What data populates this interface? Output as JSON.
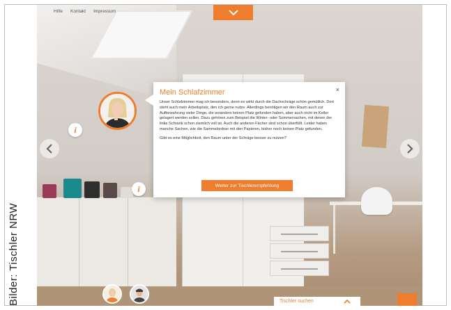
{
  "credit": "Bilder: Tischler NRW",
  "topnav": {
    "help": "Hilfe",
    "contact": "Kontakt",
    "imprint": "Impressum"
  },
  "dialog": {
    "title": "Mein Schlafzimmer",
    "close": "×",
    "paragraph1": "Unser Schlafzimmer mag ich besonders, denn es wirkt durch die Dachschräge schön gemütlich. Dort steht auch mein Arbeitsplatz, den ich gerne nutze. Allerdings benötigen wir den Raum auch zur Aufbewahrung vieler Dinge, die woanders keinen Platz gefunden haben, aber auch nicht im Keller gelagert werden sollen. Dazu gehören zum Beispiel die Winter- oder Sommersachen, mit denen der linke Schrank schon ziemlich voll ist. Auch die anderen Fächer sind schon überfüllt. Leider haben manche Sachen, wie die Sammelordner mit den Papieren, bisher noch keinen Platz gefunden.",
    "paragraph2": "Gibt es eine Möglichkeit, den Raum unter der Schräge besser zu nutzen?",
    "button": "Weiter zur Tischlerempfehlung"
  },
  "info_glyph": "i",
  "bottom": {
    "search_label": "Tischler suchen"
  },
  "colors": {
    "accent": "#ef7d2d",
    "text": "#333333"
  },
  "icons": [
    "chevron-down-icon",
    "chevron-left-icon",
    "chevron-right-icon",
    "chevron-up-icon",
    "info-icon",
    "close-icon"
  ]
}
